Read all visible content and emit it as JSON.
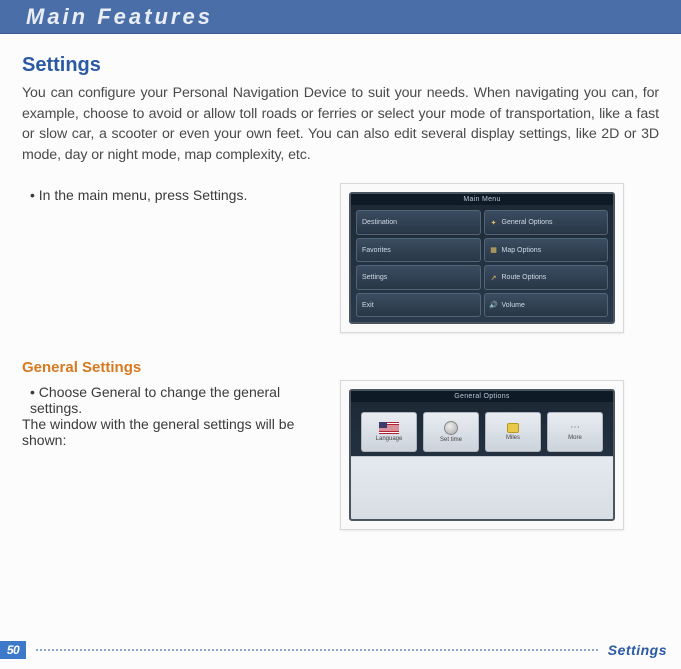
{
  "header": {
    "title": "Main Features"
  },
  "section": {
    "title": "Settings",
    "body": "You can configure your Personal Navigation Device to suit your needs. When navigating you can, for example, choose to avoid or allow toll roads or ferries or select your mode of transportation, like a fast or slow car, a scooter or even your own feet. You can also edit several display settings, like 2D or 3D mode, day or night mode, map complexity, etc.",
    "bullet1": "• In the main menu, press Settings."
  },
  "device1": {
    "title": "Main Menu",
    "buttons": [
      {
        "label": "Destination"
      },
      {
        "label": "General Options"
      },
      {
        "label": "Favorites"
      },
      {
        "label": "Map Options"
      },
      {
        "label": "Settings"
      },
      {
        "label": "Route Options"
      },
      {
        "label": "Exit"
      },
      {
        "label": "Volume"
      }
    ]
  },
  "subsection": {
    "title": "General Settings",
    "bullet": "• Choose General to change the general settings.",
    "line": "The window with the general settings will be shown:"
  },
  "device2": {
    "title": "General Options",
    "tiles": [
      {
        "label": "Language"
      },
      {
        "label": "Set time"
      },
      {
        "label": "Miles"
      },
      {
        "label": "More"
      }
    ]
  },
  "footer": {
    "page": "50",
    "label": "Settings"
  }
}
